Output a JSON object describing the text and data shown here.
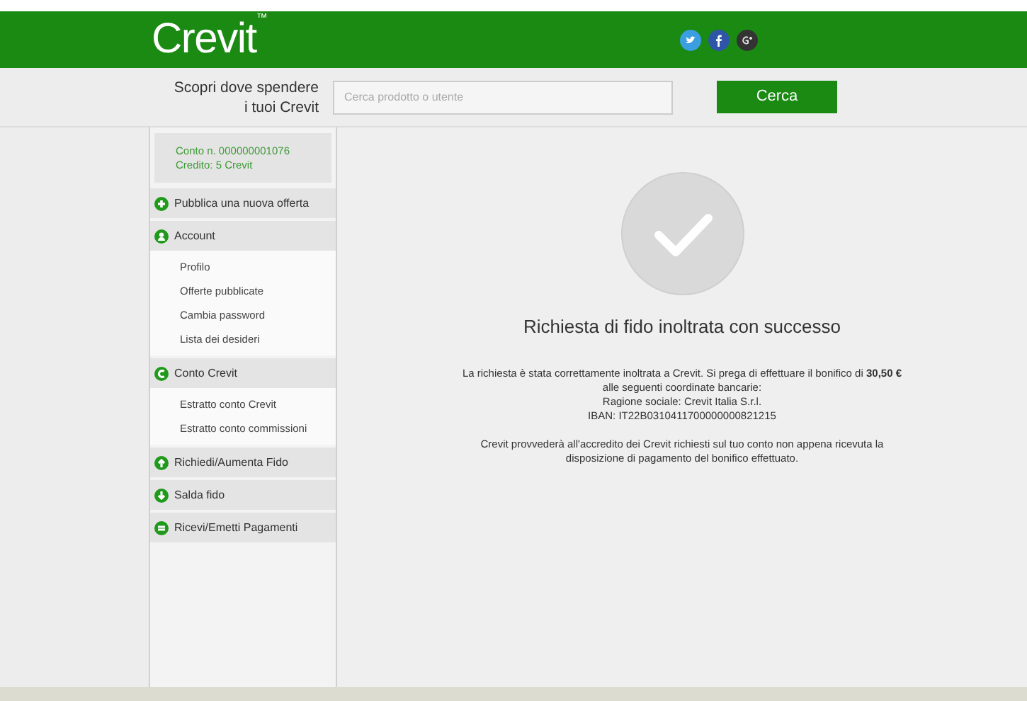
{
  "header": {
    "logo": "Crevit",
    "trademark": "™"
  },
  "search_bar": {
    "tagline_lines": [
      "Scopri dove spendere",
      "i tuoi Crevit"
    ],
    "placeholder": "Cerca prodotto o utente",
    "button": "Cerca"
  },
  "sidebar": {
    "account": {
      "number": "Conto n. 000000001076",
      "credit": "Credito: 5 Crevit"
    },
    "sections": [
      {
        "label": "Pubblica una nuova offerta",
        "kind": "plus"
      },
      {
        "label": "Account",
        "kind": "person",
        "children": [
          {
            "label": "Profilo"
          },
          {
            "label": "Offerte pubblicate"
          },
          {
            "label": "Cambia password"
          },
          {
            "label": "Lista dei desideri"
          }
        ]
      },
      {
        "label": "Conto Crevit",
        "kind": "coin",
        "children": [
          {
            "label": "Estratto conto Crevit"
          },
          {
            "label": "Estratto conto commissioni"
          }
        ]
      },
      {
        "label": "Richiedi/Aumenta Fido",
        "kind": "up"
      },
      {
        "label": "Salda fido",
        "kind": "down"
      },
      {
        "label": "Ricevi/Emetti Pagamenti",
        "kind": "equals"
      }
    ]
  },
  "main": {
    "title": "Richiesta di fido inoltrata con successo",
    "paragraphs": [
      [
        "La richiesta è stata correttamente inoltrata a Crevit. Si prega di effettuare il bonifico di **30,50 €**",
        "alle seguenti coordinate bancarie:",
        "Ragione sociale: Crevit Italia S.r.l.",
        "IBAN: IT22B0310411700000000821215"
      ],
      [
        "Crevit provvederà all'accredito dei Crevit richiesti sul tuo conto non appena ricevuta la",
        "disposizione di pagamento del bonifico effettuato."
      ]
    ]
  }
}
